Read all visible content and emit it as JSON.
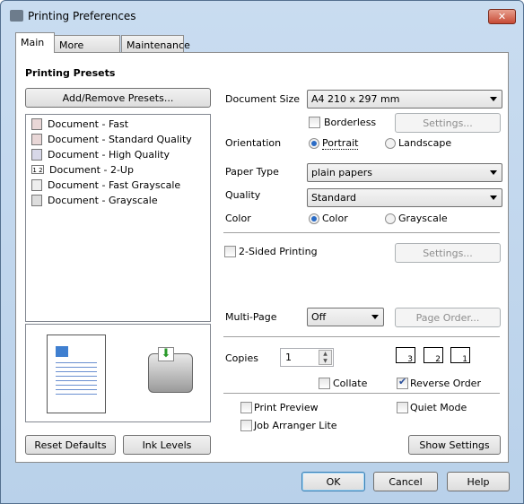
{
  "window": {
    "title": "Printing Preferences",
    "close": "✕"
  },
  "tabs": [
    {
      "label": "Main"
    },
    {
      "label": "More Options"
    },
    {
      "label": "Maintenance"
    }
  ],
  "presets": {
    "heading": "Printing Presets",
    "add_remove": "Add/Remove Presets...",
    "items": [
      {
        "label": "Document - Fast",
        "icon": "document-color-icon"
      },
      {
        "label": "Document - Standard Quality",
        "icon": "document-color-icon"
      },
      {
        "label": "Document - High Quality",
        "icon": "document-photo-icon"
      },
      {
        "label": "Document - 2-Up",
        "icon": "two-up-icon",
        "glyph": "1 2"
      },
      {
        "label": "Document - Fast Grayscale",
        "icon": "document-gray-icon"
      },
      {
        "label": "Document - Grayscale",
        "icon": "document-gray-photo-icon"
      }
    ],
    "reset_defaults": "Reset Defaults",
    "ink_levels": "Ink Levels"
  },
  "settings": {
    "document_size": {
      "label": "Document Size",
      "value": "A4 210 x 297 mm"
    },
    "borderless": {
      "label": "Borderless",
      "checked": false
    },
    "settings_button": "Settings...",
    "orientation": {
      "label": "Orientation",
      "options": [
        "Portrait",
        "Landscape"
      ],
      "selected": "Portrait"
    },
    "paper_type": {
      "label": "Paper Type",
      "value": "plain papers"
    },
    "quality": {
      "label": "Quality",
      "value": "Standard"
    },
    "color": {
      "label": "Color",
      "options": [
        "Color",
        "Grayscale"
      ],
      "selected": "Color"
    },
    "two_sided": {
      "label": "2-Sided Printing",
      "checked": false
    },
    "two_sided_settings": "Settings...",
    "multi_page": {
      "label": "Multi-Page",
      "value": "Off"
    },
    "page_order": "Page Order...",
    "copies": {
      "label": "Copies",
      "value": "1"
    },
    "copy_order_icons": [
      "3",
      "2",
      "1"
    ],
    "collate": {
      "label": "Collate",
      "checked": false
    },
    "reverse_order": {
      "label": "Reverse Order",
      "checked": true
    },
    "print_preview": {
      "label": "Print Preview",
      "checked": false
    },
    "quiet_mode": {
      "label": "Quiet Mode",
      "checked": false
    },
    "job_arranger": {
      "label": "Job Arranger Lite",
      "checked": false
    },
    "show_settings": "Show Settings"
  },
  "footer": {
    "ok": "OK",
    "cancel": "Cancel",
    "help": "Help"
  }
}
